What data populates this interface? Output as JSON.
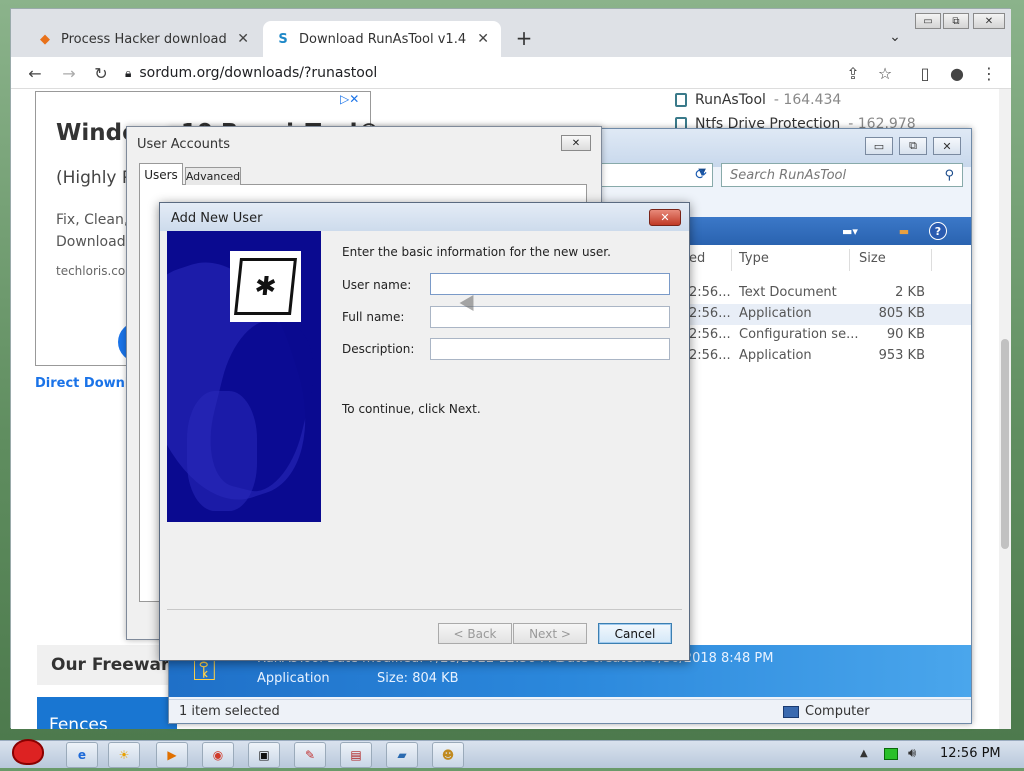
{
  "browser": {
    "tabs": [
      {
        "label": "Process Hacker download | So",
        "favicon": "diamond-icon",
        "color": "#e8711a"
      },
      {
        "label": "Download RunAsTool v1.4",
        "favicon": "sordum-s-icon",
        "color": "#1e88c8"
      }
    ],
    "url": "sordum.org/downloads/?runastool",
    "window_controls": {
      "minimize": "▭",
      "restore": "⧉",
      "close": "✕"
    }
  },
  "page": {
    "ad": {
      "title": "Windows 10 RepairTool©",
      "subtitle": "(Highly Re",
      "desc_line1": "Fix, Clean,",
      "desc_line2": "Download",
      "domain": "techloris.co",
      "choices_icon": "▷✕"
    },
    "direct_download": "Direct Downlo",
    "our_freeware": "Our Freeware",
    "banner_text": "Fences",
    "downloads": [
      {
        "name": "RunAsTool",
        "count": " - 164.434"
      },
      {
        "name": "Ntfs Drive Protection",
        "count": " - 162.978"
      }
    ]
  },
  "explorer": {
    "search_placeholder": "Search RunAsTool",
    "columns": {
      "date": "ed",
      "type": "Type",
      "size": "Size"
    },
    "files": [
      {
        "date": "2:56...",
        "type": "Text Document",
        "size": "2 KB"
      },
      {
        "date": "2:56...",
        "type": "Application",
        "size": "805 KB",
        "selected": true
      },
      {
        "date": "2:56...",
        "type": "Configuration se...",
        "size": "90 KB"
      },
      {
        "date": "2:56...",
        "type": "Application",
        "size": "953 KB"
      }
    ],
    "details": {
      "line1": "RunAsTool  Date modified: 7/28/2022 12:56 PM",
      "type": "Application",
      "size": "Size: 804 KB",
      "created": "Date created: 9/30/2018 8:48 PM"
    },
    "status_left": "1 item selected",
    "status_right": "Computer"
  },
  "user_accounts": {
    "title": "User Accounts",
    "tabs": [
      "Users",
      "Advanced"
    ]
  },
  "add_user": {
    "title": "Add New User",
    "intro": "Enter the basic information for the new user.",
    "fields": {
      "username_label": "User name:",
      "username_value": "",
      "fullname_label": "Full name:",
      "fullname_value": "",
      "description_label": "Description:",
      "description_value": ""
    },
    "continue_text": "To continue, click Next.",
    "buttons": {
      "back": "< Back",
      "next": "Next >",
      "cancel": "Cancel"
    }
  },
  "taskbar": {
    "clock": "12:56 PM"
  },
  "colors": {
    "banner_blue": "#0a0a90",
    "explorer_accent": "#2a63b0",
    "link_blue": "#1a73e8"
  }
}
